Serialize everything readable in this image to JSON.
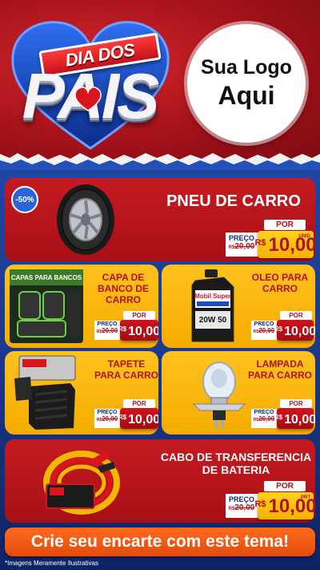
{
  "header": {
    "banner_text": "DIA DOS",
    "big_text": "PAIS",
    "logo_line1": "Sua Logo",
    "logo_line2": "Aqui"
  },
  "colors": {
    "red": "#c51b22",
    "yellow": "#ffc21e",
    "blue": "#1b3a8e",
    "orange": "#ff6a1f"
  },
  "products": [
    {
      "name": "PNEU DE CARRO",
      "badge": "-50%",
      "por": "POR",
      "preco_label": "PREÇO",
      "old_prefix": "R$",
      "old_price": "20,00",
      "currency": "R$",
      "price": "10,00",
      "unit": "UNID",
      "icon": "tire-icon"
    },
    {
      "name": "CAPA DE BANCO DE CARRO",
      "por": "POR",
      "preco_label": "PREÇO",
      "old_prefix": "R$",
      "old_price": "20,00",
      "currency": "R$",
      "price": "10,00",
      "unit": "",
      "icon": "seat-cover-icon",
      "package_text": "CAPAS PARA BANCOS"
    },
    {
      "name": "OLEO PARA CARRO",
      "por": "POR",
      "preco_label": "PREÇO",
      "old_prefix": "R$",
      "old_price": "20,00",
      "currency": "R$",
      "price": "10,00",
      "unit": "",
      "icon": "oil-bottle-icon",
      "bottle_brand": "Mobil Super",
      "bottle_grade": "20W 50"
    },
    {
      "name": "TAPETE PARA CARRO",
      "por": "POR",
      "preco_label": "PREÇO",
      "old_prefix": "R$",
      "old_price": "20,00",
      "currency": "R$",
      "price": "10,00",
      "unit": "",
      "icon": "floor-mat-icon"
    },
    {
      "name": "LAMPADA PARA CARRO",
      "por": "POR",
      "preco_label": "PREÇO",
      "old_prefix": "R$",
      "old_price": "20,00",
      "currency": "R$",
      "price": "10,00",
      "unit": "",
      "icon": "headlight-bulb-icon"
    },
    {
      "name": "CABO DE TRANSFERENCIA DE BATERIA",
      "por": "POR",
      "preco_label": "PREÇO",
      "old_prefix": "R$",
      "old_price": "20,00",
      "currency": "R$",
      "price": "10,00",
      "unit": "PRT",
      "icon": "jumper-cable-icon"
    }
  ],
  "cta": "Crie seu encarte com este tema!",
  "footnote": "*Imagens Meramente Ilustrativas"
}
